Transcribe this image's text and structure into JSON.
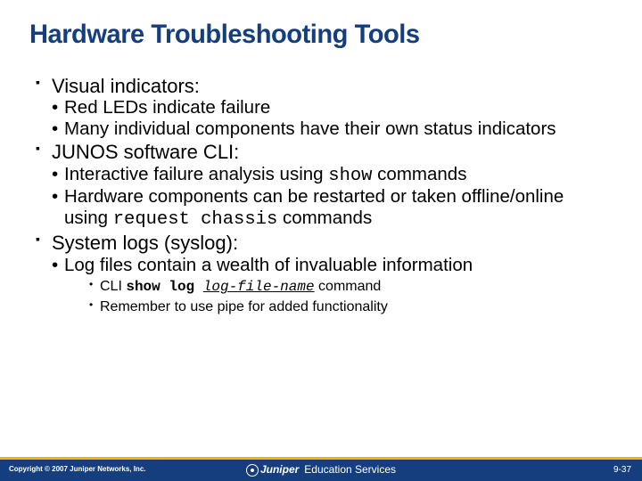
{
  "title": "Hardware Troubleshooting Tools",
  "bullets": {
    "s1": "Visual indicators:",
    "s1a": "Red LEDs indicate failure",
    "s1b": "Many individual components have their own status indicators",
    "s2": "JUNOS software CLI:",
    "s2a_pre": "Interactive failure analysis using ",
    "s2a_cmd": "show",
    "s2a_post": " commands",
    "s2b_pre": "Hardware components can be restarted or taken offline/online using ",
    "s2b_cmd": "request chassis",
    "s2b_post": " commands",
    "s3": "System logs (syslog):",
    "s3a": "Log files contain a wealth of invaluable information",
    "s3b_pre": "CLI ",
    "s3b_cmd": "show log ",
    "s3b_arg": "log-file-name",
    "s3b_post": " command",
    "s3c": "Remember to use pipe for added functionality"
  },
  "footer": {
    "copyright": "Copyright © 2007 Juniper Networks, Inc.",
    "brand": "Juniper",
    "service": "Education Services",
    "page": "9-37"
  }
}
